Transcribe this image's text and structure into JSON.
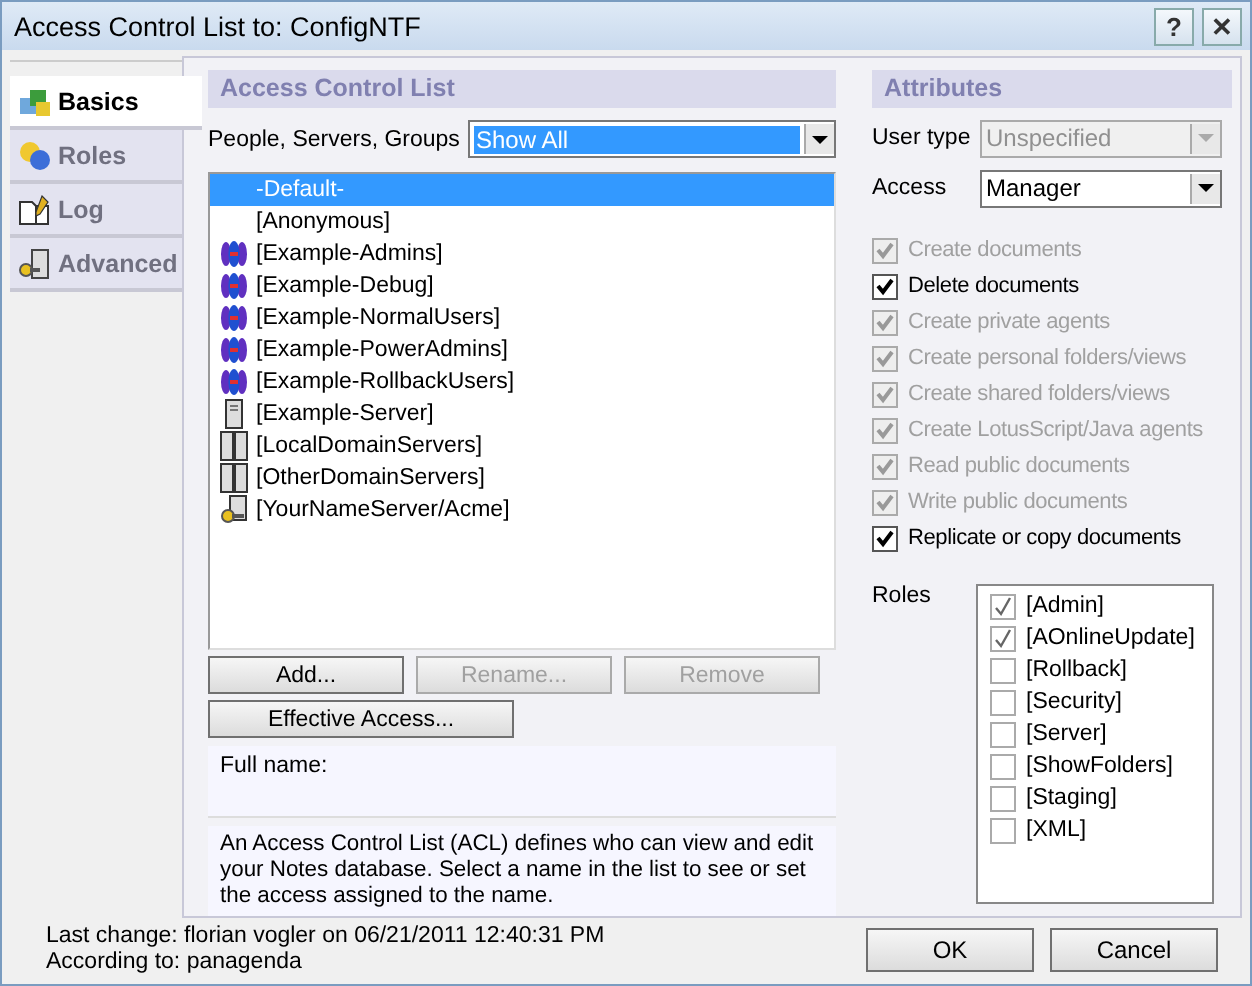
{
  "window": {
    "title": "Access Control List to: ConfigNTF",
    "buttons": [
      "?",
      "✕"
    ]
  },
  "tabs": [
    {
      "label": "Basics",
      "kind": "basics",
      "selected": true
    },
    {
      "label": "Roles",
      "kind": "roles",
      "selected": false
    },
    {
      "label": "Log",
      "kind": "log",
      "selected": false
    },
    {
      "label": "Advanced",
      "kind": "advanced",
      "selected": false
    }
  ],
  "acl": {
    "header": "Access Control List",
    "filter_label": "People, Servers, Groups",
    "filter_value": "Show All",
    "entries": [
      {
        "name": "-Default-",
        "kind": "none",
        "selected": true
      },
      {
        "name": "[Anonymous]",
        "kind": "none",
        "selected": false
      },
      {
        "name": "[Example-Admins]",
        "kind": "group",
        "selected": false
      },
      {
        "name": "[Example-Debug]",
        "kind": "group",
        "selected": false
      },
      {
        "name": "[Example-NormalUsers]",
        "kind": "group",
        "selected": false
      },
      {
        "name": "[Example-PowerAdmins]",
        "kind": "group",
        "selected": false
      },
      {
        "name": "[Example-RollbackUsers]",
        "kind": "group",
        "selected": false
      },
      {
        "name": "[Example-Server]",
        "kind": "server",
        "selected": false
      },
      {
        "name": "[LocalDomainServers]",
        "kind": "servers",
        "selected": false
      },
      {
        "name": "[OtherDomainServers]",
        "kind": "servers",
        "selected": false
      },
      {
        "name": "[YourNameServer/Acme]",
        "kind": "keyserver",
        "selected": false
      }
    ],
    "buttons": [
      {
        "label": "Add...",
        "disabled": false
      },
      {
        "label": "Rename...",
        "disabled": true
      },
      {
        "label": "Remove",
        "disabled": true
      }
    ],
    "effective_button": "Effective Access...",
    "full_name_label": "Full name:",
    "description": "An Access Control List (ACL) defines who can view and edit your Notes database.  Select a name in the list to see or set the access assigned to the name."
  },
  "attributes": {
    "header": "Attributes",
    "user_type": {
      "label": "User type",
      "value": "Unspecified",
      "disabled": true
    },
    "access": {
      "label": "Access",
      "value": "Manager",
      "disabled": false
    },
    "permissions": [
      {
        "label": "Create documents",
        "checked": true,
        "disabled": true
      },
      {
        "label": "Delete documents",
        "checked": true,
        "disabled": false
      },
      {
        "label": "Create private agents",
        "checked": true,
        "disabled": true
      },
      {
        "label": "Create personal folders/views",
        "checked": true,
        "disabled": true
      },
      {
        "label": "Create shared folders/views",
        "checked": true,
        "disabled": true
      },
      {
        "label": "Create LotusScript/Java agents",
        "checked": true,
        "disabled": true
      },
      {
        "label": "Read public documents",
        "checked": true,
        "disabled": true
      },
      {
        "label": "Write public documents",
        "checked": true,
        "disabled": true
      },
      {
        "label": "Replicate or copy documents",
        "checked": true,
        "disabled": false
      }
    ],
    "roles_label": "Roles",
    "roles": [
      {
        "name": "[Admin]",
        "checked": true
      },
      {
        "name": "[AOnlineUpdate]",
        "checked": true
      },
      {
        "name": "[Rollback]",
        "checked": false
      },
      {
        "name": "[Security]",
        "checked": false
      },
      {
        "name": "[Server]",
        "checked": false
      },
      {
        "name": "[ShowFolders]",
        "checked": false
      },
      {
        "name": "[Staging]",
        "checked": false
      },
      {
        "name": "[XML]",
        "checked": false
      }
    ]
  },
  "footer": {
    "last_change": "Last change: florian vogler on 06/21/2011 12:40:31 PM",
    "according_to": "According to: panagenda",
    "ok": "OK",
    "cancel": "Cancel"
  }
}
